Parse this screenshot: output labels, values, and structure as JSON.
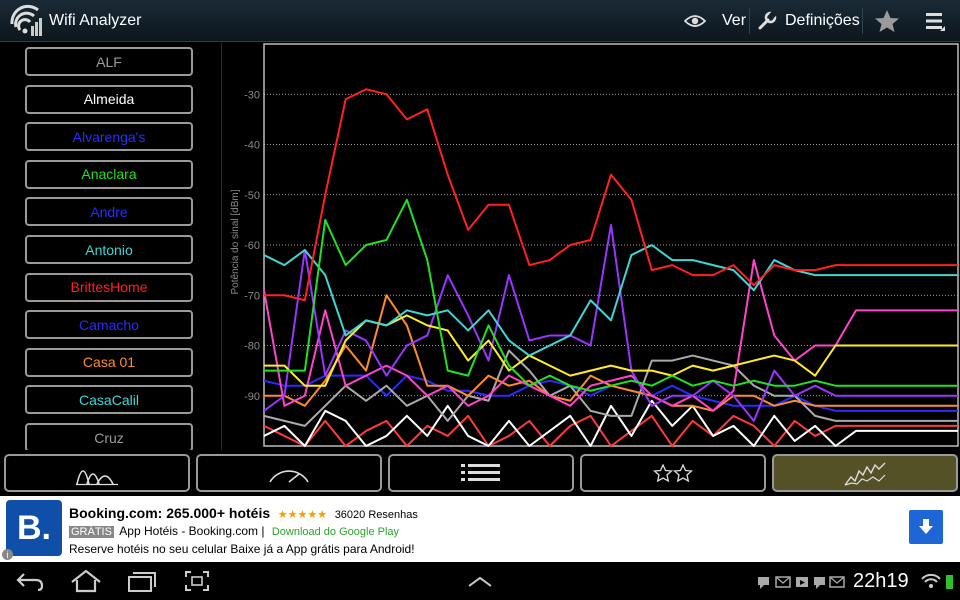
{
  "app": {
    "title": "Wifi Analyzer",
    "icon": "wifi-signal-icon"
  },
  "actionbar": {
    "view_label": "Ver",
    "view_icon": "eye-icon",
    "settings_label": "Definições",
    "settings_icon": "wrench-icon",
    "favorite_icon": "star-icon",
    "menu_icon": "overflow-menu-icon"
  },
  "ssid_list": [
    {
      "name": "ALF",
      "color": "#9a9a9a"
    },
    {
      "name": "Almeida",
      "color": "#ffffff"
    },
    {
      "name": "Alvarenga's",
      "color": "#2b2bff"
    },
    {
      "name": "Anaclara",
      "color": "#22e022"
    },
    {
      "name": "Andre",
      "color": "#2b2bff"
    },
    {
      "name": "Antonio",
      "color": "#3fd6d6"
    },
    {
      "name": "BrittesHome",
      "color": "#ff2020"
    },
    {
      "name": "Camacho",
      "color": "#2b2bff"
    },
    {
      "name": "Casa 01",
      "color": "#ff8c2a"
    },
    {
      "name": "CasaCalil",
      "color": "#3fd6d6"
    },
    {
      "name": "Cruz",
      "color": "#9a9a9a"
    }
  ],
  "graph": {
    "ylabel": "Potência do sinal [dBm]",
    "yticks": [
      "-30",
      "-40",
      "-50",
      "-60",
      "-70",
      "-80",
      "-90"
    ]
  },
  "tabs": [
    {
      "name": "channel-graph",
      "icon": "channel-graph-icon",
      "active": false
    },
    {
      "name": "signal-meter",
      "icon": "signal-meter-icon",
      "active": false
    },
    {
      "name": "ap-list",
      "icon": "ap-list-icon",
      "active": false
    },
    {
      "name": "channel-rating",
      "icon": "channel-rating-icon",
      "active": false
    },
    {
      "name": "time-graph",
      "icon": "time-graph-icon",
      "active": true
    }
  ],
  "ad": {
    "headline": "Booking.com: 265.000+ hotéis",
    "stars": "★★★★★",
    "reviews": "36020 Resenhas",
    "free_badge": "GRÁTIS",
    "app_name": "App Hotéis - Booking.com |",
    "store": "Download do Google Play",
    "body": "Reserve hotéis no seu celular Baixe já a App grátis para Android!",
    "logo_text": "B.",
    "info": "i"
  },
  "statusbar": {
    "time": "22h19"
  },
  "colors": {
    "accent_active_tab": "#545126",
    "red_series": "#ff2020",
    "green_series": "#22e022",
    "cyan_series": "#3fd6d6"
  },
  "chart_data": {
    "type": "line",
    "ylabel": "Potência do sinal [dBm]",
    "ylim": [
      -100,
      -20
    ],
    "yticks": [
      -30,
      -40,
      -50,
      -60,
      -70,
      -80,
      -90
    ],
    "x": [
      0,
      1,
      2,
      3,
      4,
      5,
      6,
      7,
      8,
      9,
      10,
      11,
      12,
      13,
      14,
      15,
      16,
      17,
      18,
      19,
      20,
      21,
      22,
      23,
      24,
      25,
      26,
      27,
      28,
      29,
      30,
      31,
      32,
      33,
      34
    ],
    "series": [
      {
        "color": "#ff2020",
        "values": [
          -70,
          -70,
          -71,
          -50,
          -31,
          -29,
          -30,
          -35,
          -33,
          -46,
          -57,
          -52,
          -52,
          -64,
          -63,
          -60,
          -59,
          -46,
          -51,
          -65,
          -64,
          -66,
          -66,
          -64,
          -68,
          -64,
          -65,
          -65,
          -64,
          -64,
          -64,
          -64,
          -64,
          -64,
          -64
        ]
      },
      {
        "color": "#22e022",
        "values": [
          -85,
          -85,
          -85,
          -55,
          -64,
          -60,
          -59,
          -51,
          -63,
          -85,
          -86,
          -76,
          -84,
          -88,
          -86,
          -88,
          -89,
          -88,
          -87,
          -88,
          -86,
          -88,
          -87,
          -88,
          -87,
          -88,
          -88,
          -87,
          -88,
          -88,
          -88,
          -88,
          -88,
          -88,
          -88
        ]
      },
      {
        "color": "#3fd6d6",
        "values": [
          -62,
          -64,
          -61,
          -66,
          -78,
          -75,
          -76,
          -73,
          -74,
          -73,
          -77,
          -73,
          -79,
          -82,
          -80,
          -78,
          -71,
          -75,
          -62,
          -60,
          -63,
          -63,
          -64,
          -65,
          -69,
          -63,
          -65,
          -66,
          -66,
          -66,
          -66,
          -66,
          -66,
          -66,
          -66
        ]
      },
      {
        "color": "#ffee22",
        "values": [
          -84,
          -84,
          -88,
          -88,
          -79,
          -75,
          -76,
          -74,
          -76,
          -77,
          -83,
          -79,
          -85,
          -82,
          -84,
          -86,
          -85,
          -84,
          -85,
          -85,
          -86,
          -84,
          -85,
          -84,
          -83,
          -82,
          -83,
          -86,
          -80,
          -80,
          -80,
          -80,
          -80,
          -80,
          -80
        ]
      },
      {
        "color": "#9a35ff",
        "values": [
          -93,
          -90,
          -61,
          -86,
          -77,
          -79,
          -86,
          -80,
          -78,
          -66,
          -74,
          -83,
          -66,
          -79,
          -78,
          -78,
          -80,
          -56,
          -85,
          -92,
          -90,
          -90,
          -87,
          -90,
          -95,
          -85,
          -90,
          -88,
          -90,
          -90,
          -90,
          -90,
          -90,
          -90,
          -90
        ]
      },
      {
        "color": "#ff44cc",
        "values": [
          -69,
          -92,
          -90,
          -73,
          -88,
          -86,
          -84,
          -86,
          -90,
          -88,
          -92,
          -90,
          -86,
          -88,
          -90,
          -92,
          -88,
          -87,
          -86,
          -90,
          -92,
          -90,
          -93,
          -89,
          -63,
          -78,
          -83,
          -80,
          -80,
          -73,
          -73,
          -73,
          -73,
          -73,
          -73
        ]
      },
      {
        "color": "#ff8c2a",
        "values": [
          -90,
          -90,
          -92,
          -87,
          -80,
          -85,
          -70,
          -76,
          -88,
          -88,
          -90,
          -86,
          -88,
          -87,
          -90,
          -91,
          -86,
          -88,
          -89,
          -90,
          -92,
          -92,
          -93,
          -90,
          -90,
          -92,
          -91,
          -92,
          -92,
          -92,
          -92,
          -92,
          -92,
          -92,
          -92
        ]
      },
      {
        "color": "#aaaaaa",
        "values": [
          -94,
          -95,
          -96,
          -92,
          -88,
          -91,
          -88,
          -92,
          -90,
          -95,
          -90,
          -91,
          -81,
          -85,
          -90,
          -88,
          -93,
          -94,
          -94,
          -83,
          -83,
          -82,
          -83,
          -84,
          -88,
          -90,
          -90,
          -94,
          -95,
          -95,
          -95,
          -95,
          -95,
          -95,
          -95
        ]
      },
      {
        "color": "#2b2bff",
        "values": [
          -87,
          -88,
          -88,
          -86,
          -86,
          -86,
          -90,
          -86,
          -87,
          -89,
          -89,
          -90,
          -90,
          -88,
          -87,
          -88,
          -90,
          -88,
          -89,
          -90,
          -88,
          -90,
          -91,
          -92,
          -92,
          -92,
          -90,
          -92,
          -93,
          -93,
          -93,
          -93,
          -93,
          -93,
          -93
        ]
      },
      {
        "color": "#ffffff",
        "values": [
          -98,
          -96,
          -100,
          -93,
          -95,
          -100,
          -98,
          -94,
          -98,
          -92,
          -98,
          -100,
          -95,
          -100,
          -97,
          -94,
          -100,
          -92,
          -98,
          -91,
          -96,
          -92,
          -98,
          -96,
          -100,
          -94,
          -99,
          -96,
          -100,
          -97,
          -97,
          -97,
          -97,
          -97,
          -97
        ]
      },
      {
        "color": "#ff3a3a",
        "values": [
          -96,
          -98,
          -100,
          -95,
          -100,
          -97,
          -95,
          -100,
          -96,
          -98,
          -94,
          -100,
          -98,
          -95,
          -100,
          -96,
          -94,
          -100,
          -97,
          -94,
          -100,
          -95,
          -98,
          -94,
          -96,
          -100,
          -95,
          -98,
          -96,
          -96,
          -96,
          -96,
          -96,
          -96,
          -96
        ]
      }
    ]
  }
}
